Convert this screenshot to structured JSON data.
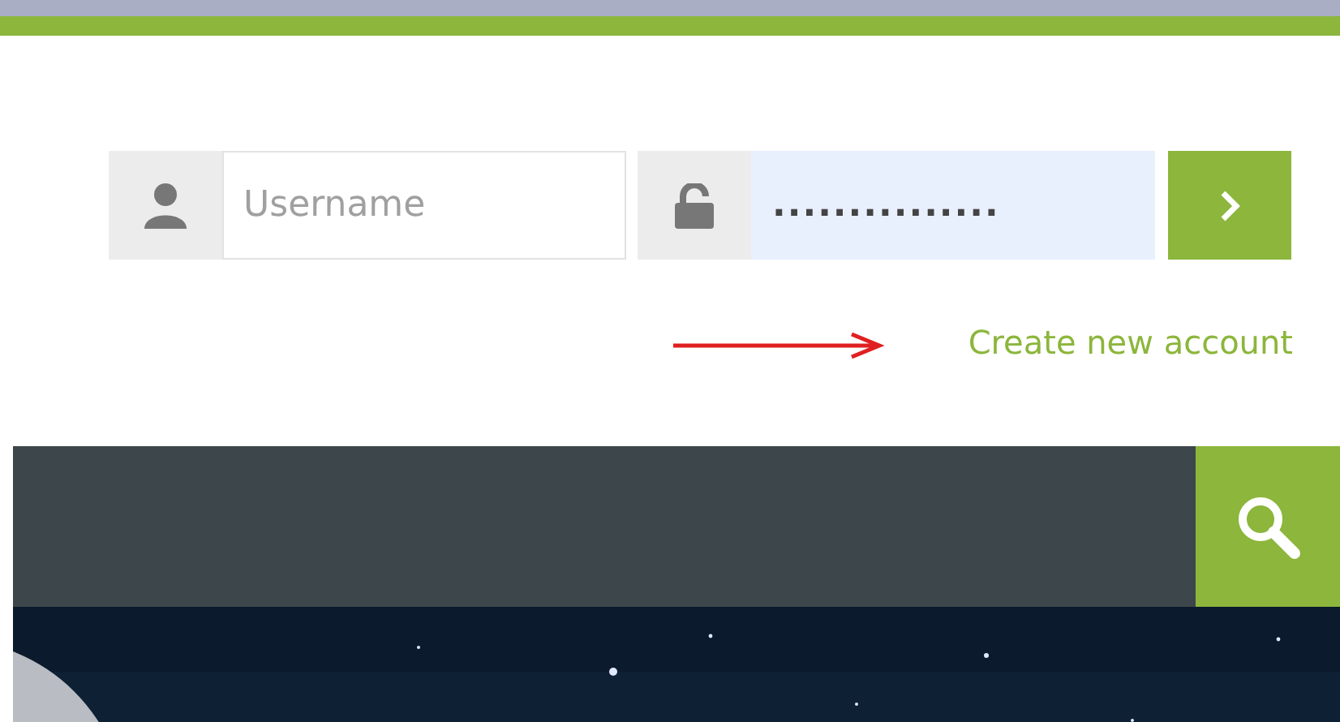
{
  "login": {
    "username": {
      "placeholder": "Username"
    },
    "password": {
      "value": "..............."
    },
    "create_account": {
      "label": "Create new account"
    }
  }
}
